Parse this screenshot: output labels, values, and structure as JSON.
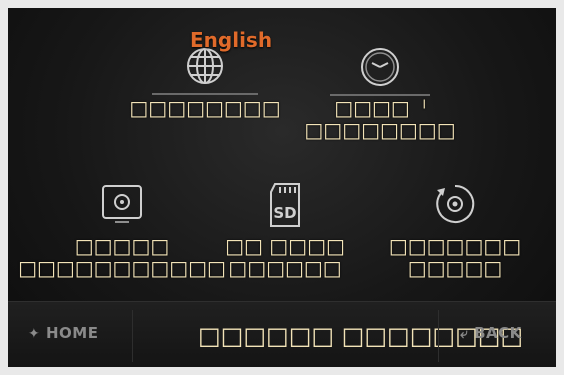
{
  "tiles": {
    "language": {
      "badge": "English",
      "label": "□□□□□□□□",
      "icon": "globe-icon"
    },
    "time": {
      "label_line1": "□□□□  ˡ",
      "label_line2": "□□□□□□□□",
      "icon": "clock-icon"
    },
    "display": {
      "label_line1": "□□□□□",
      "label_line2": "□□□□□□□□□□□",
      "icon": "display-settings-icon"
    },
    "sd_card": {
      "icon_text": "SD",
      "label_line1": "□□ □□□□",
      "label_line2": "□□□□□□",
      "icon": "sd-card-icon"
    },
    "reset": {
      "label_line1": "□□□□□□□",
      "label_line2": "□□□□□",
      "icon": "reset-gear-icon"
    }
  },
  "bottom_bar": {
    "home_label": "HOME",
    "back_label": "BACK",
    "title": "□□□□□□ □□□□□□□□"
  },
  "colors": {
    "accent": "#e06a2a",
    "label": "#f3e4b8",
    "icon": "#cfcfcf",
    "background": "#171717"
  }
}
